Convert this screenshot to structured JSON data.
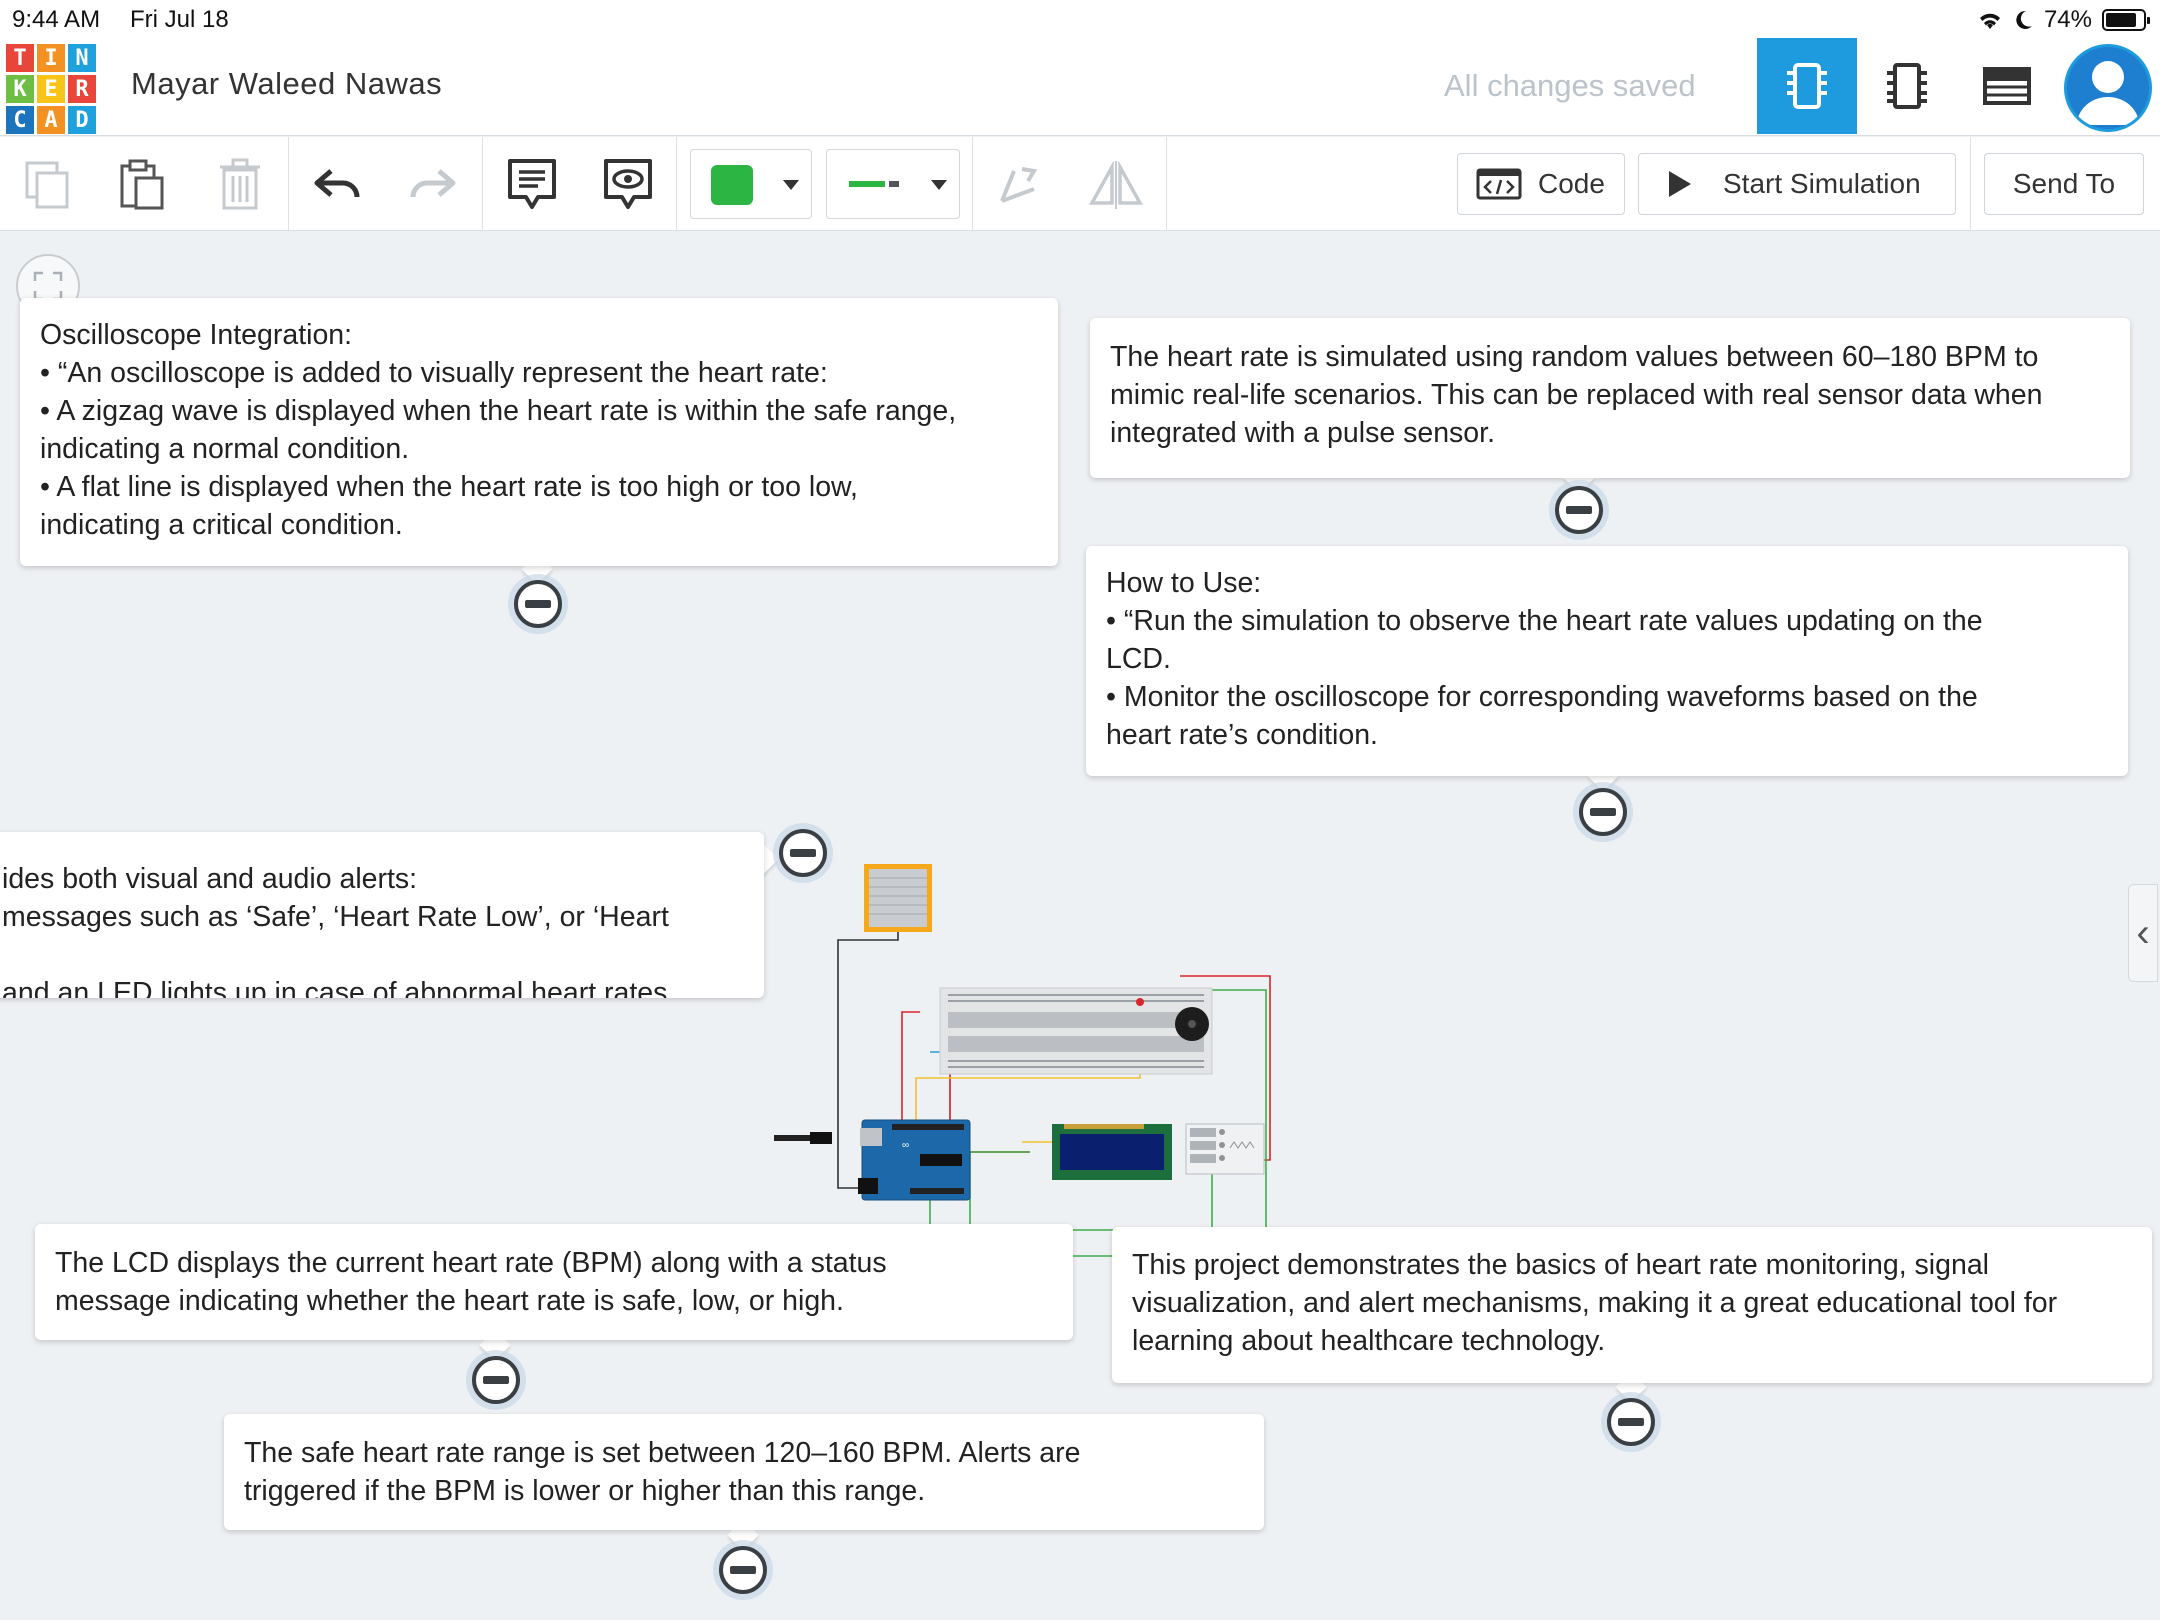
{
  "status_bar": {
    "time": "9:44 AM",
    "date": "Fri Jul 18",
    "battery": "74%",
    "icons": [
      "wifi-icon",
      "moon-icon",
      "battery-icon"
    ]
  },
  "header": {
    "logo_letters": [
      "T",
      "I",
      "N",
      "K",
      "E",
      "R",
      "C",
      "A",
      "D"
    ],
    "project_name": "Mayar Waleed Nawas",
    "save_status": "All changes saved",
    "views": [
      "circuit-view-icon",
      "schematic-view-icon",
      "component-list-icon"
    ]
  },
  "toolbar": {
    "tools": [
      "copy-icon",
      "paste-icon",
      "delete-icon",
      "undo-icon",
      "redo-icon",
      "notes-icon",
      "visibility-icon"
    ],
    "color_swatch": "#2db543",
    "wire_color": "#2db543",
    "code_label": "Code",
    "start_label": "Start Simulation",
    "send_label": "Send To"
  },
  "notes": [
    {
      "lines": [
        "Oscilloscope Integration:",
        " • “An oscilloscope is added to visually represent the heart rate:",
        " • A zigzag wave is displayed when the heart rate is within the safe range,",
        "indicating a normal condition.",
        " • A flat line is displayed when the heart rate is too high or too low,",
        "indicating a critical condition."
      ]
    },
    {
      "lines": [
        "The heart rate is simulated using random values between 60–180 BPM to",
        "mimic real-life scenarios. This can be replaced with real sensor data when",
        "integrated with a pulse sensor."
      ]
    },
    {
      "lines": [
        "How to Use:",
        " • “Run the simulation to observe the heart rate values updating on the",
        "LCD.",
        " • Monitor the oscilloscope for corresponding waveforms based on the",
        "heart rate’s condition."
      ]
    },
    {
      "lines": [
        "ides both visual and audio alerts:",
        "messages such as ‘Safe’, ‘Heart Rate Low’, or ‘Heart",
        "",
        "and an LED lights up in case of abnormal heart rates."
      ]
    },
    {
      "lines": [
        "The LCD displays the current heart rate (BPM) along with a status",
        "message indicating whether the heart rate is safe, low, or high."
      ]
    },
    {
      "lines": [
        "This project demonstrates the basics of heart rate monitoring, signal",
        "visualization, and alert mechanisms, making it a great educational tool for",
        "learning about healthcare technology."
      ]
    },
    {
      "lines": [
        "The safe heart rate range is set between 120–160 BPM. Alerts are",
        "triggered if the BPM is lower or higher than this range."
      ]
    }
  ],
  "colors": {
    "accent": "#1e9ade",
    "canvas": "#eef1f4"
  }
}
